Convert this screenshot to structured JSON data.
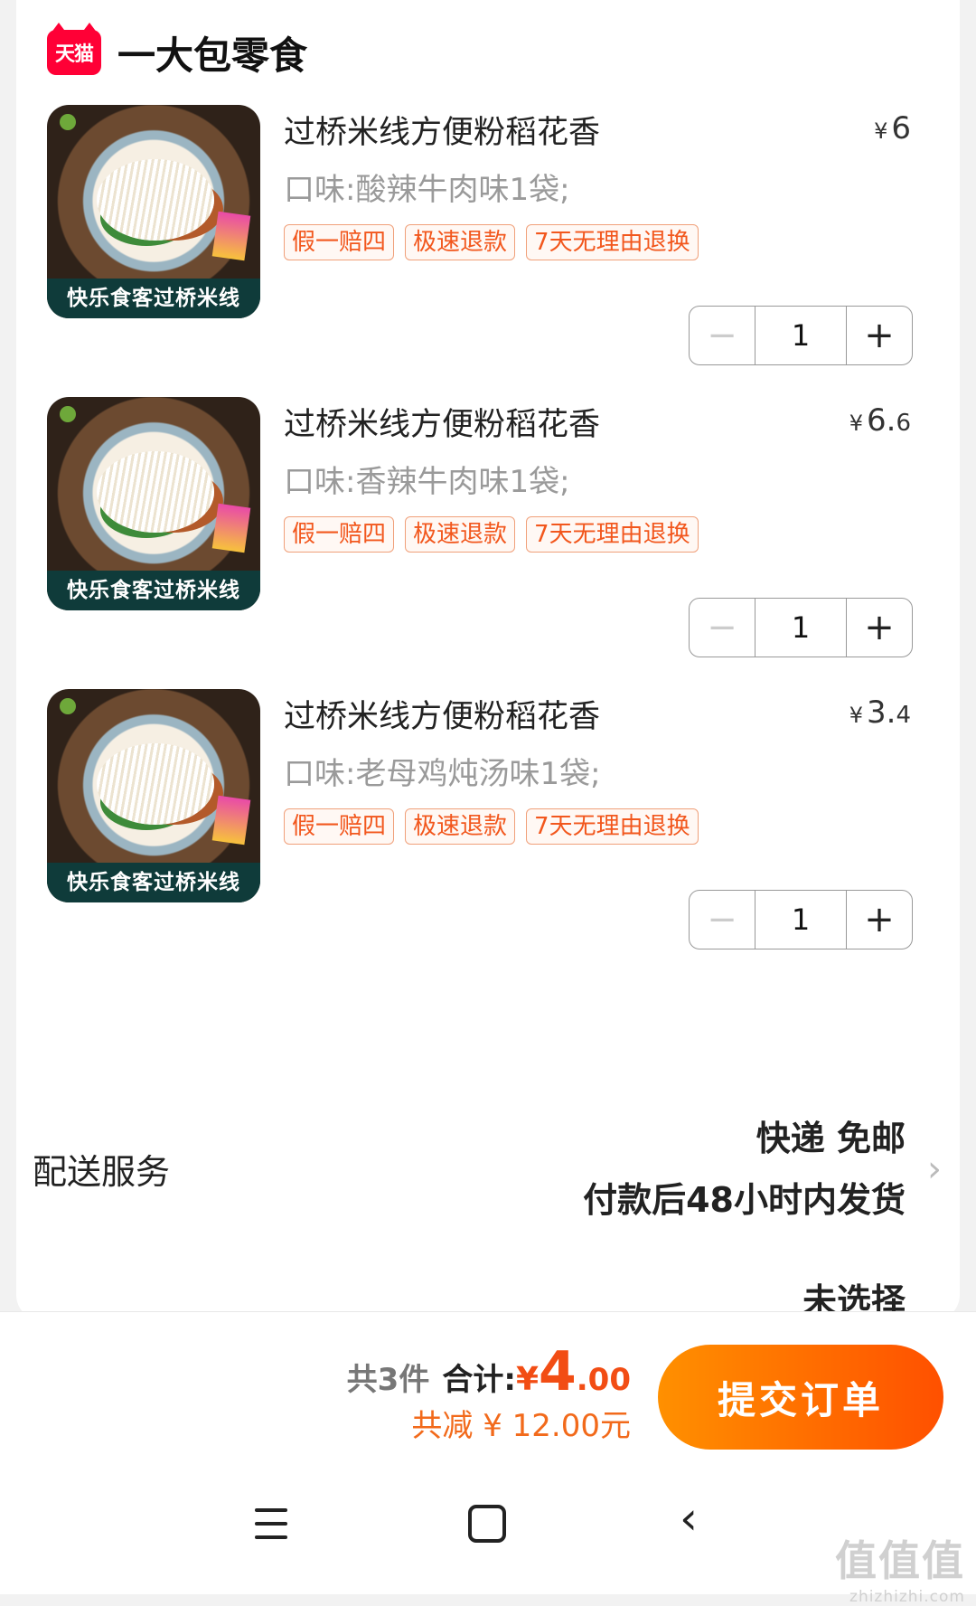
{
  "shop": {
    "logo_text": "天猫",
    "name": "一大包零食"
  },
  "items": [
    {
      "title": "过桥米线方便粉稻花香",
      "price_symbol": "¥",
      "price_int": "6",
      "price_dec": "",
      "flavor": "口味:酸辣牛肉味1袋;",
      "image_banner": "快乐食客过桥米线",
      "tags": [
        "假一赔四",
        "极速退款",
        "7天无理由退换"
      ],
      "quantity": "1"
    },
    {
      "title": "过桥米线方便粉稻花香",
      "price_symbol": "¥",
      "price_int": "6.",
      "price_dec": "6",
      "flavor": "口味:香辣牛肉味1袋;",
      "image_banner": "快乐食客过桥米线",
      "tags": [
        "假一赔四",
        "极速退款",
        "7天无理由退换"
      ],
      "quantity": "1"
    },
    {
      "title": "过桥米线方便粉稻花香",
      "price_symbol": "¥",
      "price_int": "3.",
      "price_dec": "4",
      "flavor": "口味:老母鸡炖汤味1袋;",
      "image_banner": "快乐食客过桥米线",
      "tags": [
        "假一赔四",
        "极速退款",
        "7天无理由退换"
      ],
      "quantity": "1"
    }
  ],
  "stepper": {
    "minus": "−",
    "plus": "+"
  },
  "delivery": {
    "label": "配送服务",
    "line1": "快递 免邮",
    "line2": "付款后48小时内发货",
    "chevron": "›"
  },
  "next_option": {
    "value": "未选择"
  },
  "summary": {
    "count": "共3件",
    "total_label": "合计:",
    "total_yen": "¥",
    "total_int": "4",
    "total_dec": ".00",
    "discount": "共减 ¥ 12.00元"
  },
  "submit_label": "提交订单",
  "nav": {
    "back_glyph": "‹"
  },
  "watermark": {
    "line1": "值值值",
    "line2": "zhizhizhi.com"
  }
}
